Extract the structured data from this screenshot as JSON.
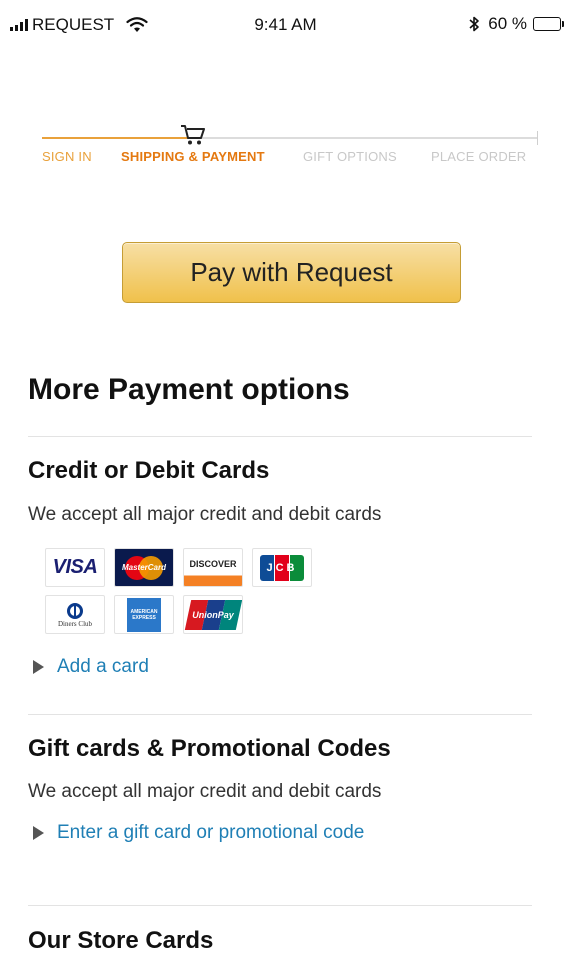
{
  "status_bar": {
    "carrier": "REQUEST",
    "time": "9:41 AM",
    "battery": "60 %",
    "battery_level": 0.6
  },
  "progress": {
    "steps": [
      {
        "label": "SIGN IN",
        "state": "done"
      },
      {
        "label": "SHIPPING & PAYMENT",
        "state": "active"
      },
      {
        "label": "GIFT OPTIONS",
        "state": "future"
      },
      {
        "label": "PLACE ORDER",
        "state": "future"
      }
    ],
    "current_step": 2,
    "accent_color": "#e9a13b"
  },
  "pay_button": {
    "label": "Pay with Request"
  },
  "more_payment": {
    "title": "More Payment options"
  },
  "credit_cards": {
    "title": "Credit or Debit Cards",
    "description": "We accept all major credit and debit cards",
    "logos": [
      {
        "name": "visa",
        "text": "VISA"
      },
      {
        "name": "mastercard",
        "text": "MasterCard"
      },
      {
        "name": "discover",
        "text": "DISCOVER"
      },
      {
        "name": "jcb",
        "text": "JCB"
      },
      {
        "name": "diners-club",
        "text": "Diners Club"
      },
      {
        "name": "american-express",
        "text": "AMERICAN EXPRESS"
      },
      {
        "name": "unionpay",
        "text": "UnionPay"
      }
    ],
    "add_link": "Add a card"
  },
  "gift_cards": {
    "title": "Gift cards & Promotional Codes",
    "description": "We accept all major credit and debit cards",
    "link": "Enter a gift card or promotional code"
  },
  "store_cards": {
    "title": "Our Store Cards"
  },
  "colors": {
    "link": "#1f7fb5",
    "button_top": "#f7dfa5",
    "button_bottom": "#f0c14b"
  }
}
